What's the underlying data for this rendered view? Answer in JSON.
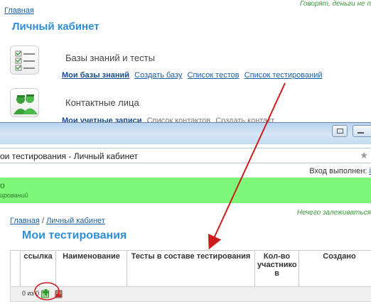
{
  "bg": {
    "breadcrumb": "Главная",
    "slogan": "Говорят, деньги не п",
    "title": "Личный кабинет",
    "section1": {
      "title": "Базы знаний и тесты",
      "icon": "checklist-icon",
      "links": [
        "Мои базы знаний",
        "Создать базу",
        "Список тестов",
        "Список тестирований"
      ]
    },
    "section2": {
      "title": "Контактные лица",
      "icon": "people-icon",
      "links": [
        "Мои учетные записи",
        "Список контактов",
        "Создать контакт"
      ]
    }
  },
  "window": {
    "tab_title": "ои тестирования - Личный кабинет",
    "login_label": "Вход выполнен:",
    "login_user": "i",
    "banner_title": "о",
    "banner_sub": "ирований",
    "breadcrumb": {
      "home": "Главная",
      "sep": "/",
      "current": "Личный кабинет"
    },
    "slogan": "Нечего залеживаться",
    "title": "Мои тестирования"
  },
  "grid": {
    "columns": [
      "ссылка",
      "Наименование",
      "Тесты в составе тестирования",
      "Кол-во участнико в",
      "Создано"
    ],
    "rows": []
  },
  "pager": {
    "count": "0 из 0",
    "add_icon": "add-green-icon",
    "delete_icon": "delete-red-icon"
  },
  "colors": {
    "accent_title": "#2f8fd6",
    "link": "#1b5d9e",
    "banner": "#7ff87a",
    "annotation": "#cc1b1b"
  }
}
